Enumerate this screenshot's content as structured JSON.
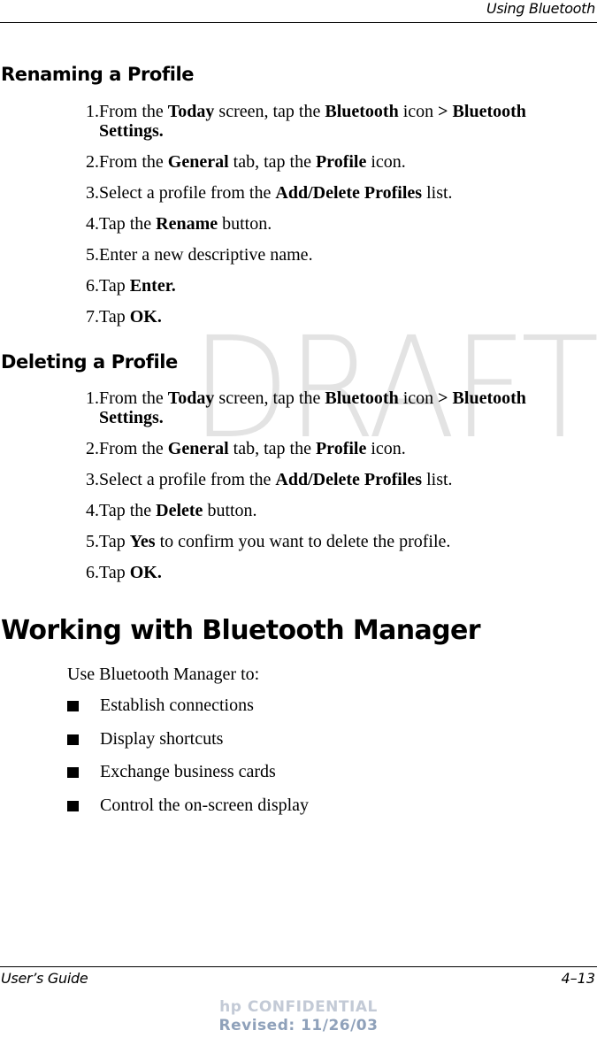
{
  "header": {
    "running_title": "Using Bluetooth"
  },
  "watermark": "DRAFT",
  "sections": [
    {
      "title": "Renaming a Profile",
      "steps": [
        {
          "num": "1.",
          "parts": [
            [
              "From the ",
              false
            ],
            [
              "Today",
              true
            ],
            [
              " screen, tap the ",
              false
            ],
            [
              "Bluetooth",
              true
            ],
            [
              " icon ",
              false
            ],
            [
              "> Bluetooth",
              true
            ]
          ],
          "cont": [
            [
              "Settings.",
              true
            ]
          ]
        },
        {
          "num": "2.",
          "parts": [
            [
              "From the ",
              false
            ],
            [
              "General",
              true
            ],
            [
              " tab, tap the ",
              false
            ],
            [
              "Profile",
              true
            ],
            [
              " icon.",
              false
            ]
          ]
        },
        {
          "num": "3.",
          "parts": [
            [
              "Select a profile from the ",
              false
            ],
            [
              "Add/Delete Profiles",
              true
            ],
            [
              " list.",
              false
            ]
          ]
        },
        {
          "num": "4.",
          "parts": [
            [
              "Tap the ",
              false
            ],
            [
              "Rename",
              true
            ],
            [
              " button.",
              false
            ]
          ]
        },
        {
          "num": "5.",
          "parts": [
            [
              "Enter a new descriptive name.",
              false
            ]
          ]
        },
        {
          "num": "6.",
          "parts": [
            [
              "Tap ",
              false
            ],
            [
              "Enter.",
              true
            ]
          ]
        },
        {
          "num": "7.",
          "parts": [
            [
              "Tap ",
              false
            ],
            [
              "OK.",
              true
            ]
          ]
        }
      ]
    },
    {
      "title": "Deleting a Profile",
      "steps": [
        {
          "num": "1.",
          "parts": [
            [
              "From the ",
              false
            ],
            [
              "Today",
              true
            ],
            [
              " screen, tap the ",
              false
            ],
            [
              "Bluetooth",
              true
            ],
            [
              " icon ",
              false
            ],
            [
              "> Bluetooth",
              true
            ]
          ],
          "cont": [
            [
              "Settings.",
              true
            ]
          ]
        },
        {
          "num": "2.",
          "parts": [
            [
              "From the ",
              false
            ],
            [
              "General",
              true
            ],
            [
              " tab, tap the ",
              false
            ],
            [
              "Profile",
              true
            ],
            [
              " icon.",
              false
            ]
          ]
        },
        {
          "num": "3.",
          "parts": [
            [
              "Select a profile from the ",
              false
            ],
            [
              "Add/Delete Profiles",
              true
            ],
            [
              " list.",
              false
            ]
          ]
        },
        {
          "num": "4.",
          "parts": [
            [
              "Tap the ",
              false
            ],
            [
              "Delete",
              true
            ],
            [
              " button.",
              false
            ]
          ]
        },
        {
          "num": "5.",
          "parts": [
            [
              "Tap ",
              false
            ],
            [
              "Yes",
              true
            ],
            [
              " to confirm you want to delete the profile.",
              false
            ]
          ]
        },
        {
          "num": "6.",
          "parts": [
            [
              "Tap ",
              false
            ],
            [
              "OK.",
              true
            ]
          ]
        }
      ]
    }
  ],
  "chapter": {
    "title": "Working with Bluetooth Manager",
    "intro": "Use Bluetooth Manager to:",
    "bullets": [
      "Establish connections",
      "Display shortcuts",
      "Exchange business cards",
      "Control the on-screen display"
    ]
  },
  "footer": {
    "left": "User’s Guide",
    "right": "4–13",
    "confidential_line1": "hp CONFIDENTIAL",
    "confidential_line2": "Revised: 11/26/03"
  }
}
